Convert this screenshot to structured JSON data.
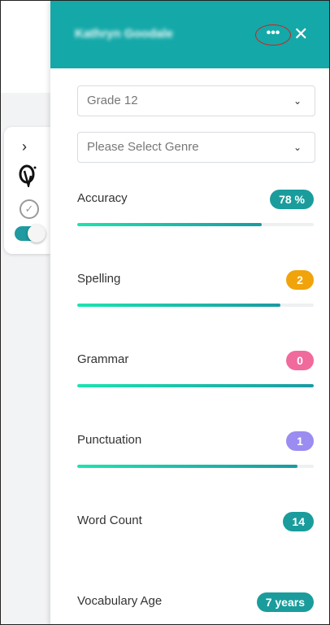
{
  "header": {
    "user_name": "Kathryn Goodale",
    "more_label": "•••",
    "close_label": "✕"
  },
  "mini_toolbar": {
    "expand_icon": "chevron-right-icon",
    "check_icon": "check-circle-icon",
    "toggle_on": true
  },
  "selects": {
    "grade": "Grade 12",
    "genre_placeholder": "Please Select Genre"
  },
  "metrics": [
    {
      "label": "Accuracy",
      "value": "78 %",
      "color": "#1a9c9c",
      "progress": 0.78
    },
    {
      "label": "Spelling",
      "value": "2",
      "color": "#f0a30a",
      "progress": 0.86
    },
    {
      "label": "Grammar",
      "value": "0",
      "color": "#f06a9b",
      "progress": 1.0
    },
    {
      "label": "Punctuation",
      "value": "1",
      "color": "#9a8cf0",
      "progress": 0.93
    },
    {
      "label": "Word Count",
      "value": "14",
      "color": "#1a9c9c"
    },
    {
      "label": "Vocabulary Age",
      "value": "7 years",
      "color": "#1a9c9c"
    }
  ],
  "colors": {
    "header_bg": "#15a8a8",
    "progress_start": "#1de3b0",
    "progress_end": "#1b9aa2"
  }
}
